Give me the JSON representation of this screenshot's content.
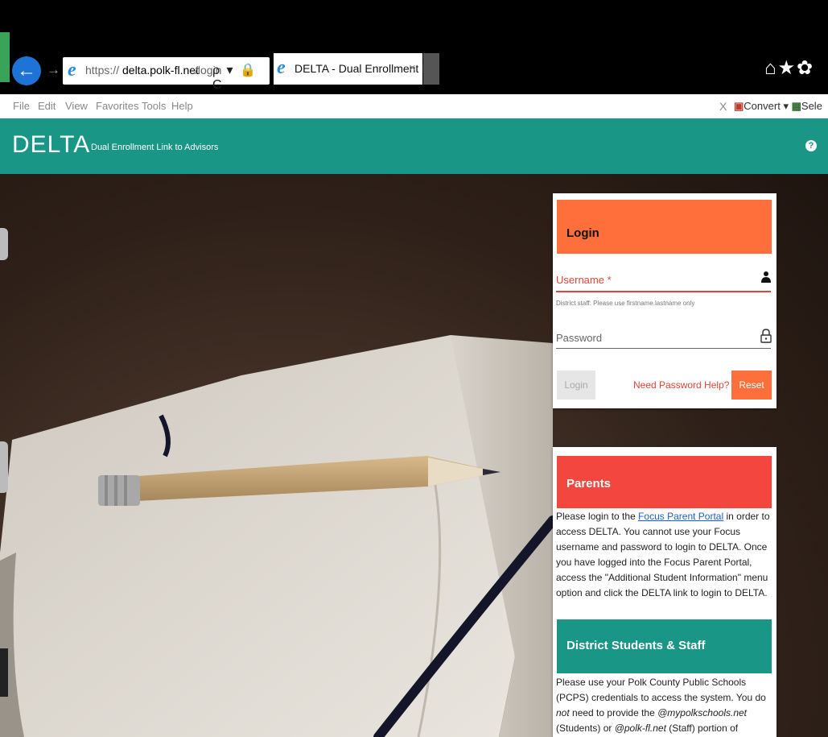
{
  "browser": {
    "url_protocol": "https://",
    "url_host": "delta.polk-fl.net",
    "url_path": "/login",
    "address_tools": "ρ ▾ 🔒 C",
    "tab_title": "DELTA - Dual Enrollment Li...",
    "tab_close": "×",
    "menu": [
      "File",
      "Edit",
      "View",
      "Favorites",
      "Tools",
      "Help"
    ],
    "toolbar_x": "X",
    "toolbar_convert": "Convert",
    "toolbar_dropdown": "▾",
    "toolbar_select": "Sele"
  },
  "app": {
    "logo": "DELTA",
    "tagline": "Dual Enrollment Link to Advisors",
    "help_label": "?"
  },
  "login": {
    "title": "Login",
    "username_label": "Username *",
    "username_hint": "District staff: Please use firstname.lastname only",
    "password_label": "Password",
    "login_button": "Login",
    "password_help": "Need Password Help?",
    "reset_button": "Reset"
  },
  "parents": {
    "title": "Parents",
    "text_before_link": "Please login to the ",
    "link": "Focus Parent Portal",
    "text_after_link": " in order to access DELTA. You cannot use your Focus username and password to login to DELTA. Once you have logged into the Focus Parent Portal, access the \"Additional Student Information\" menu option and click the DELTA link to login to DELTA."
  },
  "staff": {
    "title": "District Students & Staff",
    "text_1": "Please use your Polk County Public Schools (PCPS) credentials to access the system. You do ",
    "text_not": "not",
    "text_2": " need to provide the ",
    "domain_students": "@mypolkschools.net",
    "text_3": " (Students) or ",
    "domain_staff": "@polk-fl.net",
    "text_4": " (Staff) portion of"
  },
  "colors": {
    "header_teal": "#1a9686",
    "login_orange": "#ff6f3c",
    "parents_red": "#f2463f",
    "error_red": "#e0453a"
  },
  "icons": [
    "back-arrow-icon",
    "forward-arrow-icon",
    "ie-logo-icon",
    "search-icon",
    "lock-icon",
    "refresh-icon",
    "home-icon",
    "star-icon",
    "gear-icon",
    "help-icon",
    "user-icon",
    "padlock-icon"
  ]
}
